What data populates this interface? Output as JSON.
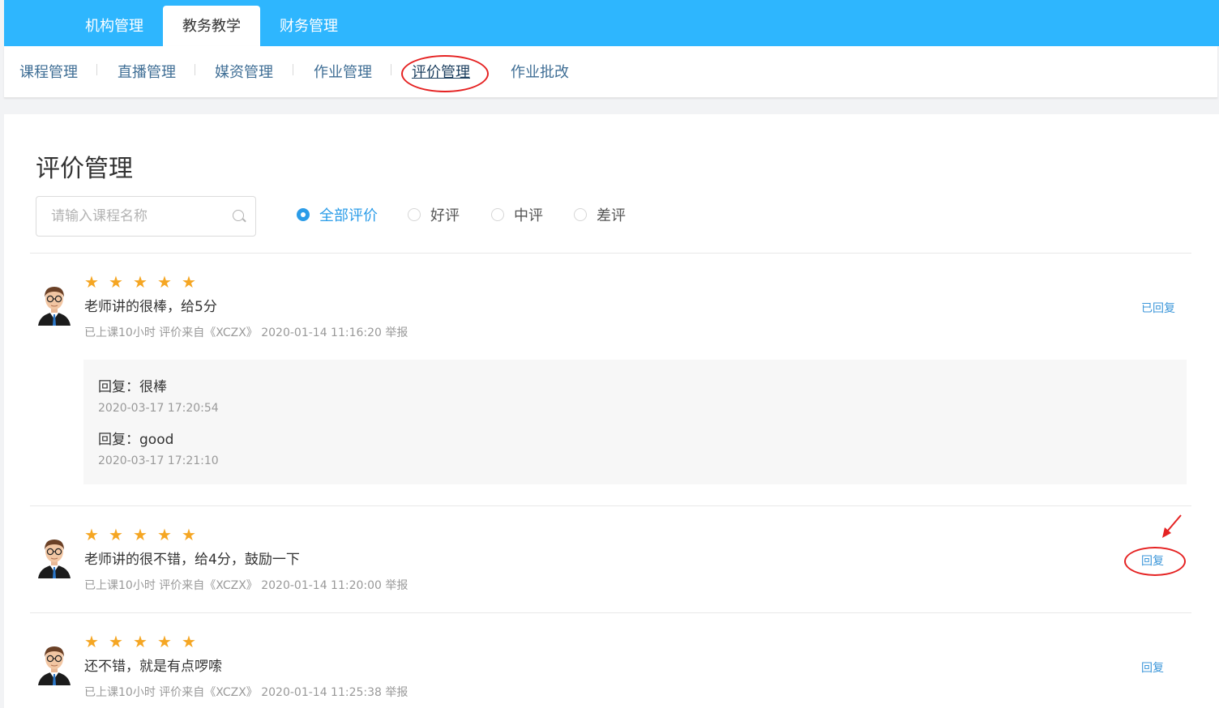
{
  "top_tabs": [
    {
      "label": "机构管理",
      "active": false
    },
    {
      "label": "教务教学",
      "active": true
    },
    {
      "label": "财务管理",
      "active": false
    }
  ],
  "sub_nav": [
    {
      "label": "课程管理",
      "active": false
    },
    {
      "label": "直播管理",
      "active": false
    },
    {
      "label": "媒资管理",
      "active": false
    },
    {
      "label": "作业管理",
      "active": false
    },
    {
      "label": "评价管理",
      "active": true
    },
    {
      "label": "作业批改",
      "active": false
    }
  ],
  "page": {
    "title": "评价管理"
  },
  "search": {
    "placeholder": "请输入课程名称",
    "value": "",
    "icon": "search-icon"
  },
  "filters": [
    {
      "label": "全部评价",
      "checked": true
    },
    {
      "label": "好评",
      "checked": false
    },
    {
      "label": "中评",
      "checked": false
    },
    {
      "label": "差评",
      "checked": false
    }
  ],
  "reviews": [
    {
      "stars": 5,
      "text": "老师讲的很棒，给5分",
      "meta": "已上课10小时 评价来自《XCZX》 2020-01-14 11:16:20 举报",
      "action": "已回复",
      "replies": [
        {
          "text": "回复：很棒",
          "time": "2020-03-17 17:20:54"
        },
        {
          "text": "回复：good",
          "time": "2020-03-17 17:21:10"
        }
      ]
    },
    {
      "stars": 5,
      "text": "老师讲的很不错，给4分，鼓励一下",
      "meta": "已上课10小时 评价来自《XCZX》 2020-01-14 11:20:00 举报",
      "action": "回复",
      "replies": []
    },
    {
      "stars": 5,
      "text": "还不错，就是有点啰嗦",
      "meta": "已上课10小时 评价来自《XCZX》 2020-01-14 11:25:38 举报",
      "action": "回复",
      "replies": []
    }
  ],
  "colors": {
    "brand": "#2eb6fe",
    "accent": "#2b9ce8",
    "star": "#f5a623",
    "annotation": "#e52222"
  }
}
